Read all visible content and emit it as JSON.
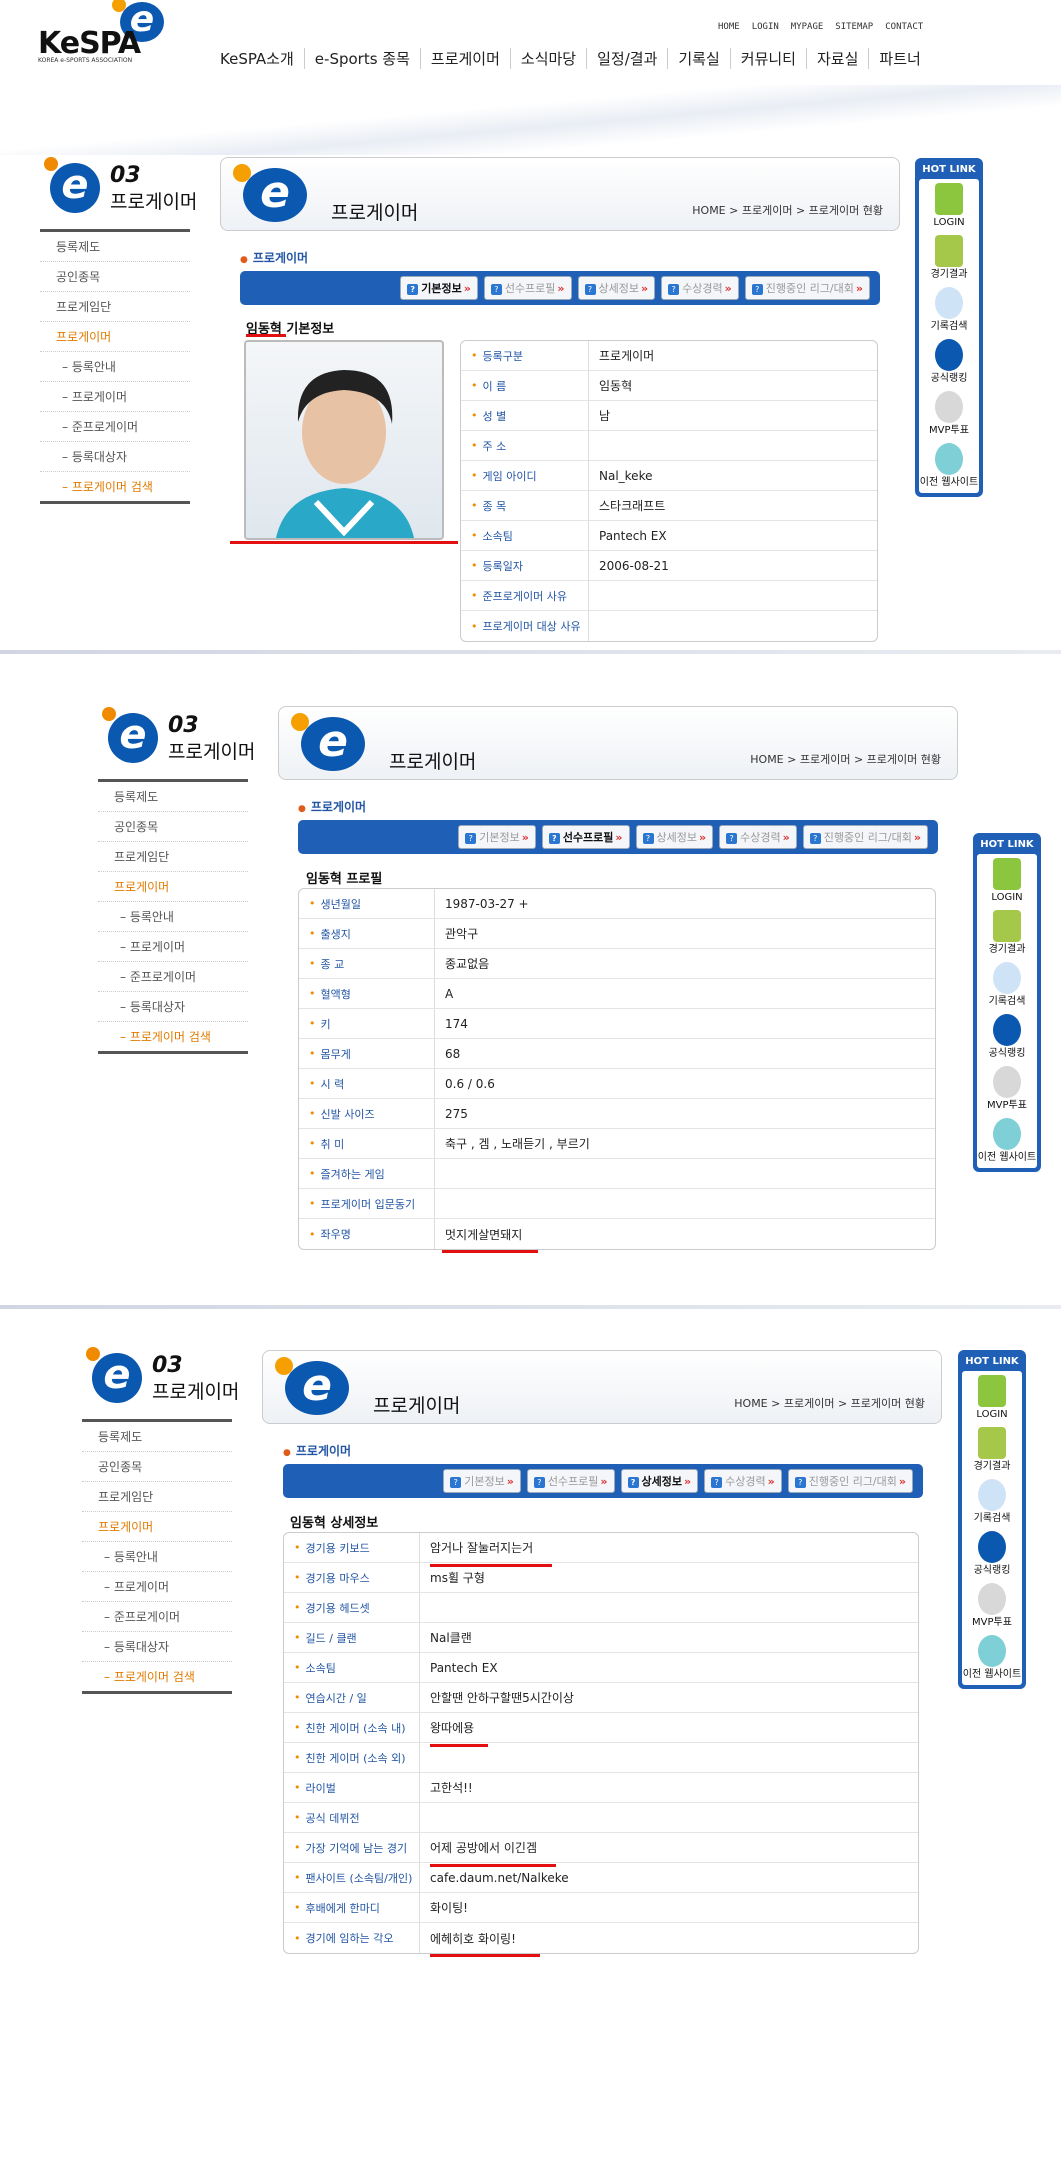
{
  "site": {
    "logo_text": "KeSPA",
    "logo_sub": "KOREA e-SPORTS ASSOCIATION",
    "topnav": [
      "HOME",
      "LOGIN",
      "MYPAGE",
      "SITEMAP",
      "CONTACT"
    ],
    "mainnav": [
      "KeSPA소개",
      "e-Sports 종목",
      "프로게이머",
      "소식마당",
      "일정/결과",
      "기록실",
      "커뮤니티",
      "자료실",
      "파트너"
    ]
  },
  "side": {
    "num": "03",
    "title": "프로게이머",
    "menu": [
      "등록제도",
      "공인종목",
      "프로게임단",
      "프로게이머",
      "– 등록안내",
      "– 프로게이머",
      "– 준프로게이머",
      "– 등록대상자",
      "– 프로게이머 검색"
    ]
  },
  "header": {
    "title": "프로게이머",
    "crumb": "HOME > 프로게이머 > 프로게이머 현황"
  },
  "subsection": "프로게이머",
  "tabs": [
    "기본정보",
    "선수프로필",
    "상세정보",
    "수상경력",
    "진행중인 리그/대회"
  ],
  "hotlink": {
    "title": "HOT LINK",
    "items": [
      "LOGIN",
      "경기결과",
      "기록검색",
      "공식랭킹",
      "MVP투표",
      "이전 웹사이트"
    ]
  },
  "basic": {
    "title_name": "임동혁",
    "title_rest": " 기본정보",
    "rows": [
      [
        "등록구분",
        "프로게이머"
      ],
      [
        "이 름",
        "임동혁"
      ],
      [
        "성 별",
        "남"
      ],
      [
        "주 소",
        ""
      ],
      [
        "게임 아이디",
        "Nal_keke"
      ],
      [
        "종 목",
        "스타크래프트"
      ],
      [
        "소속팀",
        "Pantech EX"
      ],
      [
        "등록일자",
        "2006-08-21"
      ],
      [
        "준프로게이머 사유",
        ""
      ],
      [
        "프로게이머 대상 사유",
        ""
      ]
    ]
  },
  "profile": {
    "title": "임동혁 프로필",
    "rows": [
      [
        "생년월일",
        "1987-03-27 +"
      ],
      [
        "출생지",
        "관악구"
      ],
      [
        "종 교",
        "종교없음"
      ],
      [
        "혈액형",
        "A"
      ],
      [
        "키",
        "174"
      ],
      [
        "몸무게",
        "68"
      ],
      [
        "시 력",
        "0.6 / 0.6"
      ],
      [
        "신발 사이즈",
        "275"
      ],
      [
        "취 미",
        "축구 , 겜 , 노래듣기 , 부르기"
      ],
      [
        "즐겨하는 게임",
        ""
      ],
      [
        "프로게이머 입문동기",
        ""
      ],
      [
        "좌우명",
        "멋지게살면돼지"
      ]
    ]
  },
  "detail": {
    "title": "임동혁 상세정보",
    "rows": [
      [
        "경기용 키보드",
        "암거나 잘눌러지는거"
      ],
      [
        "경기용 마우스",
        "ms휠 구형"
      ],
      [
        "경기용 헤드셋",
        ""
      ],
      [
        "길드 / 클랜",
        "Nal클랜"
      ],
      [
        "소속팀",
        "Pantech EX"
      ],
      [
        "연습시간 / 일",
        "안할땐 안하구할땐5시간이상"
      ],
      [
        "친한 게이머 (소속 내)",
        "왕따에용"
      ],
      [
        "친한 게이머 (소속 외)",
        ""
      ],
      [
        "라이벌",
        "고한석!!"
      ],
      [
        "공식 데뷔전",
        ""
      ],
      [
        "가장 기억에 남는 경기",
        "어제 공방에서 이긴겜"
      ],
      [
        "팬사이트 (소속팀/개인)",
        "cafe.daum.net/Nalkeke"
      ],
      [
        "후배에게 한마디",
        "화이팅!"
      ],
      [
        "경기에 임하는 각오",
        "에헤히호 화이링!"
      ]
    ]
  }
}
